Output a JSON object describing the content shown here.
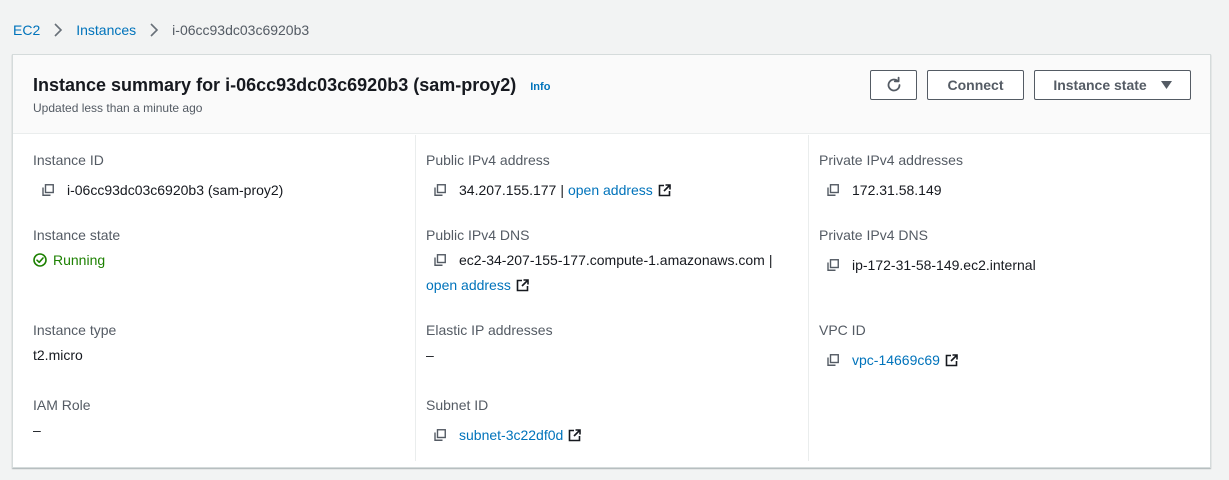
{
  "breadcrumb": {
    "items": [
      "EC2",
      "Instances"
    ],
    "current": "i-06cc93dc03c6920b3"
  },
  "header": {
    "title": "Instance summary for i-06cc93dc03c6920b3 (sam-proy2)",
    "info": "Info",
    "subtitle": "Updated less than a minute ago",
    "connect": "Connect",
    "instance_state": "Instance state"
  },
  "fields": {
    "instance_id": {
      "label": "Instance ID",
      "value": "i-06cc93dc03c6920b3 (sam-proy2)"
    },
    "instance_state": {
      "label": "Instance state",
      "value": "Running"
    },
    "instance_type": {
      "label": "Instance type",
      "value": "t2.micro"
    },
    "iam_role": {
      "label": "IAM Role",
      "value": "–"
    },
    "public_ipv4": {
      "label": "Public IPv4 address",
      "value": "34.207.155.177",
      "link": "open address"
    },
    "public_dns": {
      "label": "Public IPv4 DNS",
      "value": "ec2-34-207-155-177.compute-1.amazonaws.com",
      "link": "open address"
    },
    "elastic_ip": {
      "label": "Elastic IP addresses",
      "value": "–"
    },
    "subnet_id": {
      "label": "Subnet ID",
      "value": "subnet-3c22df0d"
    },
    "private_ipv4": {
      "label": "Private IPv4 addresses",
      "value": "172.31.58.149"
    },
    "private_dns": {
      "label": "Private IPv4 DNS",
      "value": "ip-172-31-58-149.ec2.internal"
    },
    "vpc_id": {
      "label": "VPC ID",
      "value": "vpc-14669c69"
    }
  },
  "icons": {
    "breadcrumb_separator": "chevron-right-icon",
    "refresh": "refresh-icon",
    "dropdown": "caret-down-icon",
    "copy": "copy-icon",
    "external": "external-link-icon",
    "status": "check-circle-icon"
  },
  "colors": {
    "link": "#0073bb",
    "success": "#1d8102",
    "label": "#545b64",
    "text": "#16191f"
  }
}
